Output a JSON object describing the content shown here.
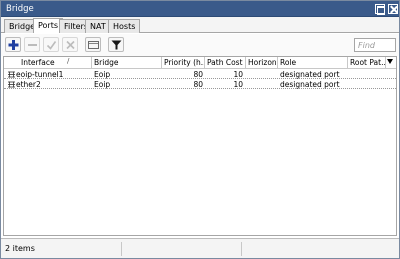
{
  "window": {
    "title": "Bridge"
  },
  "tabs": [
    {
      "label": "Bridge",
      "active": false
    },
    {
      "label": "Ports",
      "active": true
    },
    {
      "label": "Filters",
      "active": false
    },
    {
      "label": "NAT",
      "active": false
    },
    {
      "label": "Hosts",
      "active": false
    }
  ],
  "toolbar": {
    "buttons": [
      {
        "icon": "plus-icon"
      },
      {
        "icon": "minus-icon"
      },
      {
        "icon": "check-icon"
      },
      {
        "icon": "cross-icon"
      },
      {
        "icon": "comment-icon"
      },
      {
        "icon": "filter-icon"
      }
    ],
    "find_placeholder": "Find"
  },
  "table": {
    "columns": [
      "Interface",
      "Bridge",
      "Priority (h...",
      "Path Cost",
      "Horizon",
      "Role",
      "Root Pat..."
    ],
    "rows": [
      {
        "interface": "eoip-tunnel1",
        "bridge": "Eoip",
        "priority": "80",
        "path_cost": "10",
        "horizon": "",
        "role": "designated port",
        "root_path": ""
      },
      {
        "interface": "ether2",
        "bridge": "Eoip",
        "priority": "80",
        "path_cost": "10",
        "horizon": "",
        "role": "designated port",
        "root_path": ""
      }
    ]
  },
  "status": {
    "count": "2 items"
  },
  "colors": {
    "titlebar": "#3a5a8a",
    "plus": "#1f3fa0"
  }
}
